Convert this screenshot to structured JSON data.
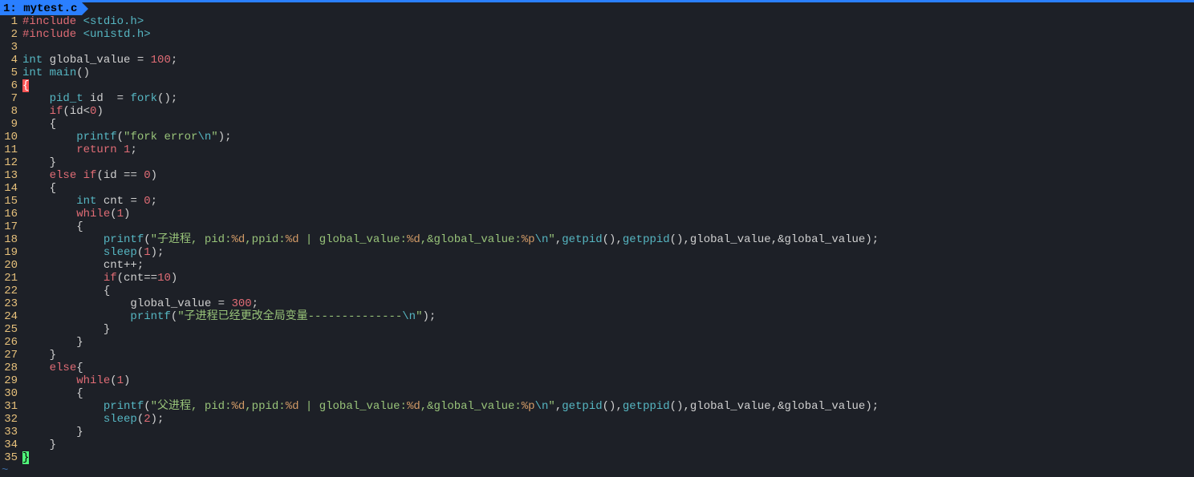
{
  "tab": {
    "label": "1: mytest.c"
  },
  "lines": {
    "l1": {
      "num": "1"
    },
    "l2": {
      "num": "2"
    },
    "l3": {
      "num": "3"
    },
    "l4": {
      "num": "4"
    },
    "l5": {
      "num": "5"
    },
    "l6": {
      "num": "6"
    },
    "l7": {
      "num": "7"
    },
    "l8": {
      "num": "8"
    },
    "l9": {
      "num": "9"
    },
    "l10": {
      "num": "10"
    },
    "l11": {
      "num": "11"
    },
    "l12": {
      "num": "12"
    },
    "l13": {
      "num": "13"
    },
    "l14": {
      "num": "14"
    },
    "l15": {
      "num": "15"
    },
    "l16": {
      "num": "16"
    },
    "l17": {
      "num": "17"
    },
    "l18": {
      "num": "18"
    },
    "l19": {
      "num": "19"
    },
    "l20": {
      "num": "20"
    },
    "l21": {
      "num": "21"
    },
    "l22": {
      "num": "22"
    },
    "l23": {
      "num": "23"
    },
    "l24": {
      "num": "24"
    },
    "l25": {
      "num": "25"
    },
    "l26": {
      "num": "26"
    },
    "l27": {
      "num": "27"
    },
    "l28": {
      "num": "28"
    },
    "l29": {
      "num": "29"
    },
    "l30": {
      "num": "30"
    },
    "l31": {
      "num": "31"
    },
    "l32": {
      "num": "32"
    },
    "l33": {
      "num": "33"
    },
    "l34": {
      "num": "34"
    },
    "l35": {
      "num": "35"
    }
  },
  "tok": {
    "include1_pre": "#include ",
    "include1_path": "<stdio.h>",
    "include2_pre": "#include ",
    "include2_path": "<unistd.h>",
    "int": "int",
    "global_decl": " global_value = ",
    "hundred": "100",
    "semi": ";",
    "main": " main",
    "parens": "()",
    "obrace": "{",
    "cbrace": "}",
    "pid_t": "pid_t",
    "id_decl": " id  = ",
    "fork": "fork",
    "call_end": "();",
    "if": "if",
    "cond_idlt0": "(id<",
    "zero": "0",
    "cparen": ")",
    "indent4": "    ",
    "indent8": "        ",
    "indent12": "            ",
    "indent16": "                ",
    "printf": "printf",
    "oparen": "(",
    "str_fork_err_a": "\"fork error",
    "esc_n": "\\n",
    "str_close": "\"",
    "call_close": ");",
    "return": "return",
    "sp": " ",
    "one": "1",
    "else": "else",
    "cond_ideq0": "(id == ",
    "cnt_decl": " cnt = ",
    "while": "while",
    "oparen_one_cparen": "(",
    "str_child_a": "\"子进程, pid:",
    "fmt_d": "%d",
    "str_ppid": ",ppid:",
    "str_gv": " | global_value:",
    "str_agv": ",&global_value:",
    "fmt_p": "%p",
    "comma": ",",
    "getpid": "getpid",
    "getppid": "getppid",
    "gv_args": ",global_value,&global_value);",
    "sleep": "sleep",
    "arg1": "(",
    "cntpp": "cnt++;",
    "cond_cnt10": "(cnt==",
    "ten": "10",
    "gv_assign": "global_value = ",
    "three_hundred": "300",
    "str_child_changed": "\"子进程已经更改全局变量--------------",
    "else_brace": "else{",
    "str_parent_a": "\"父进程, pid:",
    "two": "2",
    "tilde": "~"
  }
}
